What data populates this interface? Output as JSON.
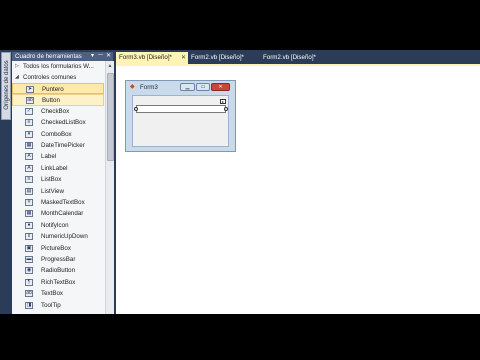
{
  "origins_tab": {
    "label": "Orígenes de datos"
  },
  "toolbox": {
    "title": "Cuadro de herramientas",
    "pin_glyph": "▾",
    "autohide_glyph": "ᅳ",
    "close_glyph": "✕",
    "categories": [
      {
        "label": "Todos los formularios W...",
        "arrow": "▷"
      },
      {
        "label": "Controles comunes",
        "arrow": "◢"
      }
    ],
    "items": [
      {
        "label": "Puntero",
        "icon": "pointer-icon",
        "glyph": "➤"
      },
      {
        "label": "Button",
        "icon": "button-icon",
        "glyph": "ab"
      },
      {
        "label": "CheckBox",
        "icon": "checkbox-icon",
        "glyph": "✓"
      },
      {
        "label": "CheckedListBox",
        "icon": "checkedlistbox-icon",
        "glyph": "≡"
      },
      {
        "label": "ComboBox",
        "icon": "combobox-icon",
        "glyph": "▾"
      },
      {
        "label": "DateTimePicker",
        "icon": "datetimepicker-icon",
        "glyph": "▦"
      },
      {
        "label": "Label",
        "icon": "label-icon",
        "glyph": "A"
      },
      {
        "label": "LinkLabel",
        "icon": "linklabel-icon",
        "glyph": "A"
      },
      {
        "label": "ListBox",
        "icon": "listbox-icon",
        "glyph": "≡"
      },
      {
        "label": "ListView",
        "icon": "listview-icon",
        "glyph": "▤"
      },
      {
        "label": "MaskedTextBox",
        "icon": "maskedtextbox-icon",
        "glyph": "#"
      },
      {
        "label": "MonthCalendar",
        "icon": "monthcalendar-icon",
        "glyph": "▦"
      },
      {
        "label": "NotifyIcon",
        "icon": "notifyicon-icon",
        "glyph": "●"
      },
      {
        "label": "NumericUpDown",
        "icon": "numericupdown-icon",
        "glyph": "⇕"
      },
      {
        "label": "PictureBox",
        "icon": "picturebox-icon",
        "glyph": "▣"
      },
      {
        "label": "ProgressBar",
        "icon": "progressbar-icon",
        "glyph": "▬"
      },
      {
        "label": "RadioButton",
        "icon": "radiobutton-icon",
        "glyph": "◉"
      },
      {
        "label": "RichTextBox",
        "icon": "richtextbox-icon",
        "glyph": "¶"
      },
      {
        "label": "TextBox",
        "icon": "textbox-icon",
        "glyph": "ab"
      },
      {
        "label": "ToolTip",
        "icon": "tooltip-icon",
        "glyph": "◨"
      }
    ],
    "selected_index": 0,
    "hover_index": 1
  },
  "tabs": [
    {
      "label": "Form3.vb [Diseño]*",
      "active": true,
      "close": "✕"
    },
    {
      "label": "Form2.vb [Diseño]*",
      "active": false
    },
    {
      "label": "Form2.vb [Diseño]*",
      "active": false
    }
  ],
  "form": {
    "title": "Form3",
    "minimize_glyph": "▁",
    "maximize_glyph": "▭",
    "close_glyph": "✕",
    "smart_tag_glyph": "▸"
  },
  "colors": {
    "ide_background": "#2b3c59",
    "active_tab": "#fff3b5",
    "selected_item": "#fde9a8"
  }
}
